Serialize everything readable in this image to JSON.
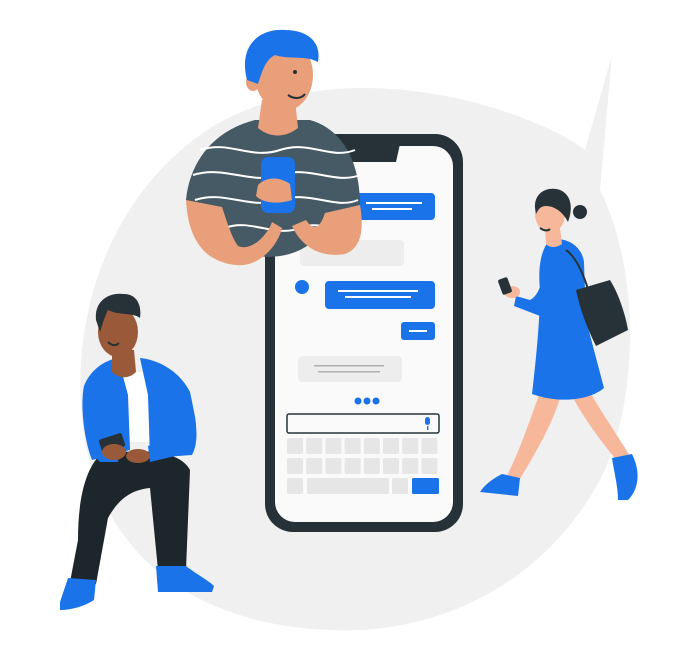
{
  "colors": {
    "background": "#ffffff",
    "bubble": "#f0f0f0",
    "accent": "#1a73e8",
    "accent_dark": "#0f5cc7",
    "phone_frame": "#263238",
    "phone_screen": "#fafafa",
    "gray_bubble": "#ededed",
    "key": "#e6e6e6",
    "skin_light": "#e9a07a",
    "skin_pale": "#f6b79a",
    "skin_dark": "#9a5a3a",
    "hair_dark": "#263238",
    "shirt_gray": "#455a64",
    "pants_dark": "#1c262b"
  },
  "illustration": {
    "icons": [
      "speech-bubble-background",
      "smartphone",
      "microphone-icon",
      "typing-indicator-dots"
    ],
    "figures": [
      "standing-man-holding-phone",
      "seated-man-using-phone",
      "walking-woman-using-phone"
    ]
  }
}
